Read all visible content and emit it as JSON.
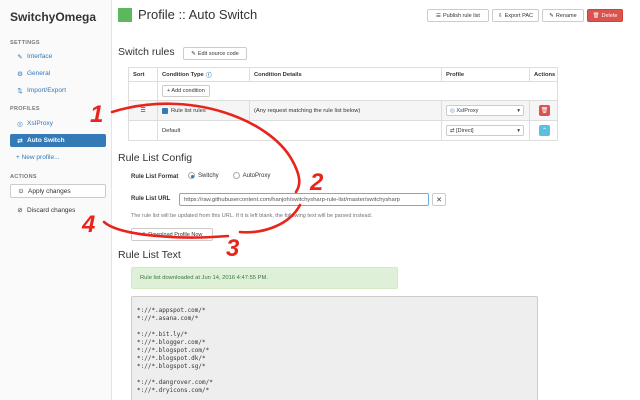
{
  "brand": "SwitchyOmega",
  "sidebar": {
    "settings_header": "SETTINGS",
    "settings_items": [
      {
        "icon": "wrench-icon",
        "label": "Interface"
      },
      {
        "icon": "gear-icon",
        "label": "General"
      },
      {
        "icon": "import-export-icon",
        "label": "Import/Export"
      }
    ],
    "profiles_header": "PROFILES",
    "profile_items": [
      {
        "icon": "globe-icon",
        "label": "XsIProxy"
      },
      {
        "icon": "switch-icon",
        "label": "Auto Switch"
      }
    ],
    "new_profile": "+ New profile...",
    "actions_header": "ACTIONS",
    "apply_changes": "Apply changes",
    "discard_changes": "Discard changes"
  },
  "header": {
    "title": "Profile :: Auto Switch",
    "color": "#5cb85c",
    "buttons": {
      "publish": "Publish rule list",
      "export": "Export PAC",
      "rename": "Rename",
      "delete": "Delete"
    }
  },
  "switch_rules": {
    "title": "Switch rules",
    "edit_source": "Edit source code",
    "columns": {
      "sort": "Sort",
      "condition_type": "Condition Type",
      "condition_details": "Condition Details",
      "profile": "Profile",
      "actions": "Actions"
    },
    "add_condition": "+ Add condition",
    "rule_row": {
      "condition_type": "Rule list rules",
      "condition_details": "(Any request matching the rule list below)",
      "profile": "XsIProxy"
    },
    "default_row": {
      "label": "Default",
      "profile": "[Direct]"
    }
  },
  "rule_list_config": {
    "title": "Rule List Config",
    "format_label": "Rule List Format",
    "format_options": [
      "Switchy",
      "AutoProxy"
    ],
    "selected_format": "Switchy",
    "url_label": "Rule List URL",
    "url_value": "https://raw.githubusercontent.com/hanjoh/switchysharp-rule-list/master/switchysharp",
    "help": "The rule list will be updated from this URL. If it is left blank, the following text will be parsed instead.",
    "download_button": "Download Profile Now"
  },
  "rule_list_text": {
    "title": "Rule List Text",
    "status": "Rule list downloaded at Jun 14, 2016 4:47:55 PM.",
    "lines": [
      "*://*.appspot.com/*",
      "*://*.asana.com/*",
      "",
      "*://*.bit.ly/*",
      "*://*.blogger.com/*",
      "*://*.blogspot.com/*",
      "*://*.blogspot.dk/*",
      "*://*.blogspot.sg/*",
      "",
      "*://*.dangrover.com/*",
      "*://*.dryicons.com/*"
    ]
  },
  "annotations": {
    "numbers": [
      "1",
      "2",
      "3",
      "4"
    ],
    "color": "#e8241c"
  }
}
